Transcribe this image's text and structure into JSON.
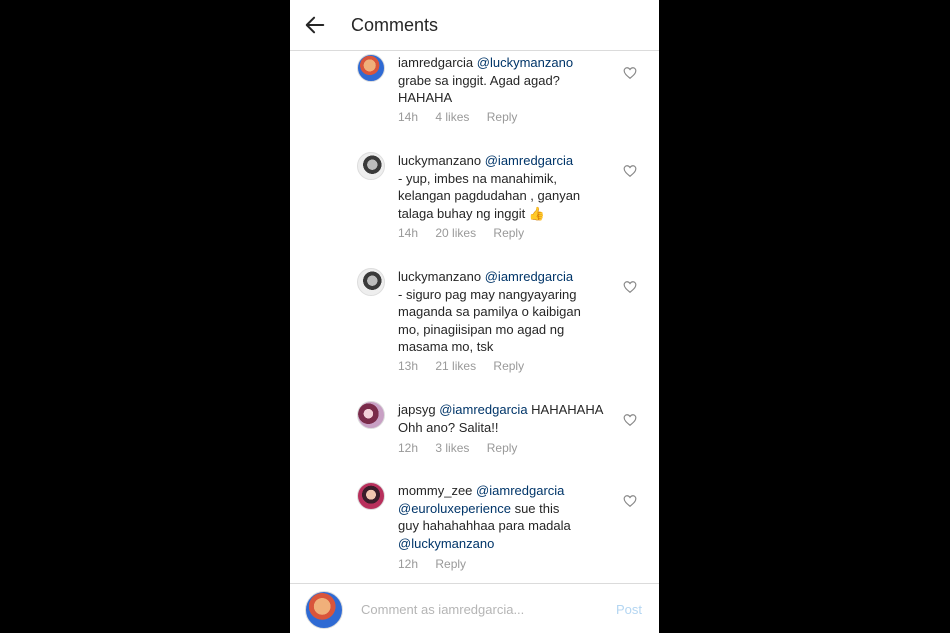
{
  "header": {
    "title": "Comments",
    "back_icon": "arrow-left-icon"
  },
  "comments": [
    {
      "username": "iamredgarcia",
      "mention": "@luckymanzano",
      "lines": [
        "grabe sa inggit. Agad agad?",
        "HAHAHA"
      ],
      "time": "14h",
      "likes": "4 likes",
      "reply": "Reply",
      "avatar": "avatar-red"
    },
    {
      "username": "luckymanzano",
      "mention": "@iamredgarcia",
      "lines": [
        "- yup, imbes na manahimik,",
        "kelangan pagdudahan , ganyan",
        "talaga buhay ng inggit 👍"
      ],
      "time": "14h",
      "likes": "20 likes",
      "reply": "Reply",
      "avatar": "avatar-bw"
    },
    {
      "username": "luckymanzano",
      "mention": "@iamredgarcia",
      "lines": [
        "- siguro pag may nangyayaring",
        "maganda sa pamilya o kaibigan",
        "mo, pinagiisipan mo agad ng",
        "masama mo, tsk"
      ],
      "time": "13h",
      "likes": "21 likes",
      "reply": "Reply",
      "avatar": "avatar-bw"
    },
    {
      "username": "japsyg",
      "mention": "@iamredgarcia",
      "after_mention": "HAHAHAHA",
      "lines": [
        "Ohh ano? Salita!!"
      ],
      "time": "12h",
      "likes": "3 likes",
      "reply": "Reply",
      "avatar": "avatar-jap"
    },
    {
      "username": "mommy_zee",
      "mention": "@iamredgarcia",
      "mention2": "@euroluxeperience",
      "after_mention2": "sue this",
      "line3": "guy hahahahhaa para madala",
      "mention3": "@luckymanzano",
      "time": "12h",
      "reply": "Reply",
      "avatar": "avatar-mom"
    }
  ],
  "footer": {
    "placeholder": "Comment as iamredgarcia...",
    "post_label": "Post"
  },
  "colors": {
    "mention": "#003569",
    "meta": "#999999",
    "post_disabled": "#b4d6f2",
    "divider": "#dbdbdb"
  }
}
